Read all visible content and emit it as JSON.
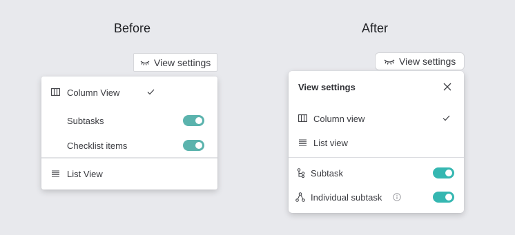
{
  "before": {
    "heading": "Before",
    "button_label": "View settings",
    "items": {
      "column_view": "Column View",
      "subtasks": "Subtasks",
      "checklist_items": "Checklist items",
      "list_view": "List View"
    },
    "toggles": {
      "subtasks_on": true,
      "checklist_items_on": true
    },
    "toggle_color": "#5bb3ad"
  },
  "after": {
    "heading": "After",
    "button_label": "View settings",
    "panel_title": "View settings",
    "items": {
      "column_view": "Column view",
      "list_view": "List view",
      "subtask": "Subtask",
      "individual_subtask": "Individual subtask"
    },
    "toggles": {
      "subtask_on": true,
      "individual_subtask_on": true
    },
    "toggle_color": "#35b7b1"
  },
  "icons": [
    "eye-closed-icon",
    "columns-icon",
    "list-icon",
    "checkmark-icon",
    "close-icon",
    "subtask-icon",
    "hierarchy-icon",
    "info-icon"
  ]
}
